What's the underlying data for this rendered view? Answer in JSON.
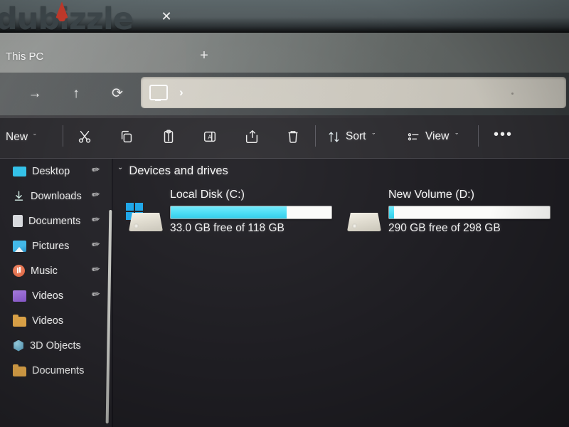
{
  "watermark": {
    "text": "dubizzle"
  },
  "window": {
    "tab_label": "This PC",
    "tab_close_icon": "close-icon",
    "new_tab_icon": "plus-icon"
  },
  "navigation": {
    "forward_icon": "arrow-right-icon",
    "up_icon": "arrow-up-icon",
    "refresh_icon": "refresh-icon",
    "address": {
      "root_icon": "this-pc-monitor-icon",
      "separator": "›",
      "value": "",
      "placeholder": ""
    }
  },
  "toolbar": {
    "new_label": "New",
    "new_chevron": "ˇ",
    "cut_icon": "scissors-icon",
    "copy_icon": "copy-icon",
    "paste_icon": "paste-icon",
    "rename_icon": "rename-icon",
    "share_icon": "share-icon",
    "delete_icon": "trash-icon",
    "sort_label": "Sort",
    "sort_icon": "sort-arrows-icon",
    "sort_chevron": "ˇ",
    "view_label": "View",
    "view_icon": "view-list-icon",
    "view_chevron": "ˇ",
    "more_label": "•••"
  },
  "sidebar": {
    "items": [
      {
        "label": "Desktop",
        "icon": "desktop-icon",
        "pinned": true
      },
      {
        "label": "Downloads",
        "icon": "downloads-icon",
        "pinned": true
      },
      {
        "label": "Documents",
        "icon": "documents-icon",
        "pinned": true
      },
      {
        "label": "Pictures",
        "icon": "pictures-icon",
        "pinned": true
      },
      {
        "label": "Music",
        "icon": "music-icon",
        "pinned": true
      },
      {
        "label": "Videos",
        "icon": "videos-icon",
        "pinned": true
      },
      {
        "label": "Videos",
        "icon": "folder-icon",
        "pinned": false
      },
      {
        "label": "3D Objects",
        "icon": "3d-objects-icon",
        "pinned": false
      },
      {
        "label": "Documents",
        "icon": "folder-icon",
        "pinned": false
      }
    ],
    "pin_glyph": "✐"
  },
  "content": {
    "group_chevron": "ˇ",
    "group_title": "Devices and drives",
    "drives": [
      {
        "name": "Local Disk (C:)",
        "usage_text": "33.0 GB free of 118 GB",
        "free": "33.0 GB",
        "total": "118 GB",
        "used_percent": 72,
        "icon": "hard-drive-windows-icon",
        "bar_color": "#45dcf4"
      },
      {
        "name": "New Volume (D:)",
        "usage_text": "290 GB free of 298 GB",
        "free": "290 GB",
        "total": "298 GB",
        "used_percent": 3,
        "icon": "hard-drive-icon",
        "bar_color": "#45dcf4"
      }
    ]
  },
  "colors": {
    "accent": "#45dcf4",
    "window_bg": "#1e1d22",
    "sidebar_bg": "#232227",
    "command_bar_bg": "#2c2b2f",
    "watermark": "#3b4448",
    "flame": "#c0392b"
  }
}
